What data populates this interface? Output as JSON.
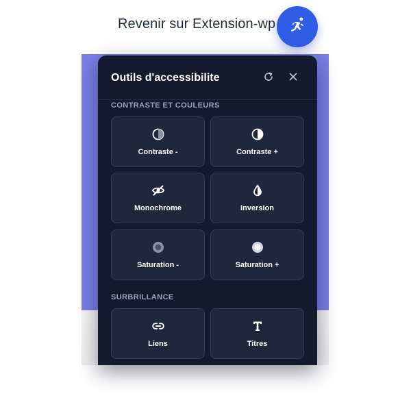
{
  "header": {
    "back_link": "Revenir sur Extension-wp",
    "fab_icon": "accessibility-person-icon"
  },
  "panel": {
    "title": "Outils d'accessibilite",
    "reset_icon": "refresh-icon",
    "close_icon": "close-icon"
  },
  "sections": {
    "contrast": {
      "label": "CONTRASTE ET COULEURS",
      "tiles": [
        {
          "label": "Contraste -",
          "icon": "contrast-minus-icon"
        },
        {
          "label": "Contraste +",
          "icon": "contrast-plus-icon"
        },
        {
          "label": "Monochrome",
          "icon": "eye-slash-icon"
        },
        {
          "label": "Inversion",
          "icon": "drop-icon"
        },
        {
          "label": "Saturation -",
          "icon": "saturation-minus-icon"
        },
        {
          "label": "Saturation +",
          "icon": "saturation-plus-icon"
        }
      ]
    },
    "highlight": {
      "label": "SURBRILLANCE",
      "tiles": [
        {
          "label": "Liens",
          "icon": "link-icon"
        },
        {
          "label": "Titres",
          "icon": "heading-icon"
        }
      ]
    }
  },
  "colors": {
    "accent": "#2f5de5",
    "panel_bg": "#141a2e",
    "tile_bg": "#1f273d",
    "page_accent": "#7a80e6"
  }
}
